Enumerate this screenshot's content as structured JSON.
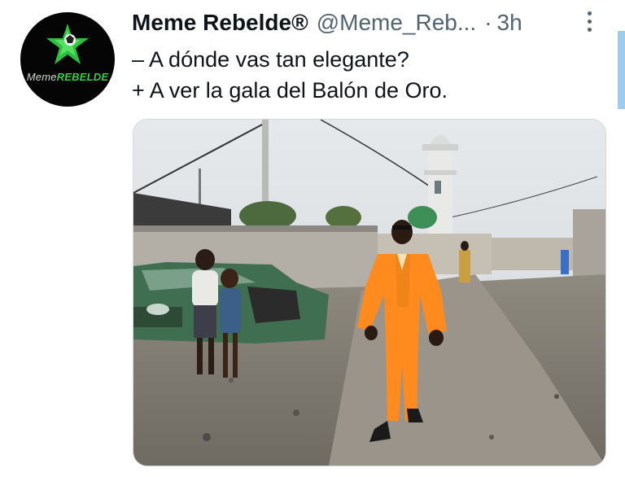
{
  "account": {
    "display_name": "Meme Rebelde®",
    "handle": "@Meme_Reb...",
    "separator": "·",
    "time": "3h",
    "avatar": {
      "text_part1": "Meme",
      "text_part2": "REBELDE",
      "icon": "star-ball-icon"
    }
  },
  "tweet": {
    "lines": [
      "– A dónde vas tan elegante?",
      "+ A ver la gala del Balón de Oro."
    ]
  },
  "icons": {
    "more": "more-vertical-icon"
  },
  "colors": {
    "accent_green": "#3cc94a",
    "secondary_text": "#536471",
    "suit_orange": "#ff8a1e",
    "side_bar": "#9ccdef"
  },
  "media": {
    "description_icon": "photo-image"
  }
}
